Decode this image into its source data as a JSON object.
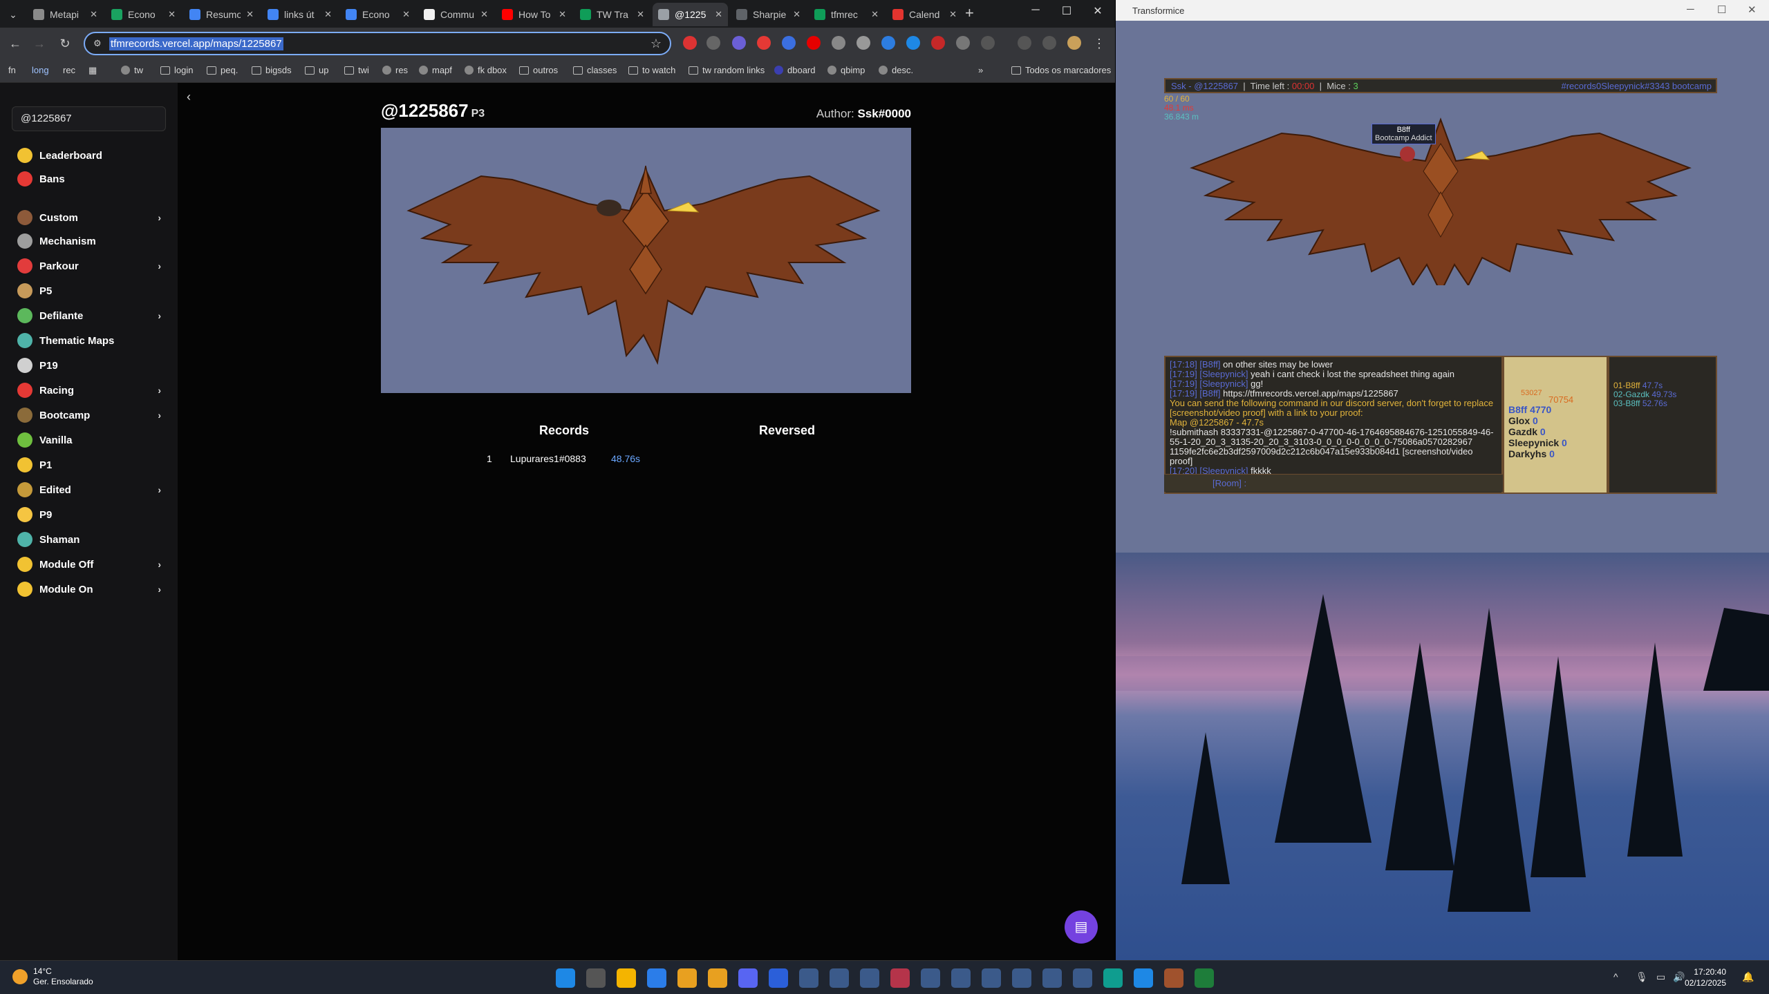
{
  "browser": {
    "tabs": [
      {
        "label": "Metapi",
        "color": "#8a8a8a",
        "active": false
      },
      {
        "label": "Econo",
        "color": "#1aa260",
        "active": false
      },
      {
        "label": "Resumo",
        "color": "#4285f4",
        "active": false
      },
      {
        "label": "links út",
        "color": "#4285f4",
        "active": false
      },
      {
        "label": "Econo",
        "color": "#4285f4",
        "active": false
      },
      {
        "label": "Commu",
        "color": "#f1f1f1",
        "active": false
      },
      {
        "label": "How To",
        "color": "#ff0000",
        "active": false
      },
      {
        "label": "TW Tra",
        "color": "#0f9d58",
        "active": false
      },
      {
        "label": "@1225",
        "color": "#9aa0a6",
        "active": true
      },
      {
        "label": "Sharpie",
        "color": "#5f6368",
        "active": false
      },
      {
        "label": "tfmrec",
        "color": "#0f9d58",
        "active": false
      },
      {
        "label": "Calend",
        "color": "#e3342f",
        "active": false
      }
    ],
    "url": "tfmrecords.vercel.app/maps/1225867",
    "bookmarks": [
      "fn",
      "long",
      "rec",
      "tw",
      "login",
      "peq.",
      "bigsds",
      "up",
      "twi",
      "res",
      "mapf",
      "fk dbox",
      "outros",
      "classes",
      "to watch",
      "tw random links",
      "dboard",
      "qbimp",
      "desc.",
      "Todos os marcadores"
    ]
  },
  "sidebar": {
    "search_value": "@1225867",
    "items": [
      {
        "label": "Leaderboard",
        "icon": "crown-icon",
        "color": "#f1c232",
        "arrow": false
      },
      {
        "label": "Bans",
        "icon": "ban-icon",
        "color": "#e53935",
        "arrow": false
      },
      {
        "label": "Custom",
        "icon": "house-icon",
        "color": "#8d5a3a",
        "arrow": true
      },
      {
        "label": "Mechanism",
        "icon": "gear-icon",
        "color": "#9e9e9e",
        "arrow": false
      },
      {
        "label": "Parkour",
        "icon": "heart-icon",
        "color": "#e23c3c",
        "arrow": true
      },
      {
        "label": "P5",
        "icon": "brush-icon",
        "color": "#c79a5a",
        "arrow": false
      },
      {
        "label": "Defilante",
        "icon": "flag-icon",
        "color": "#5cb85c",
        "arrow": true
      },
      {
        "label": "Thematic Maps",
        "icon": "sparkle-icon",
        "color": "#4fb3a9",
        "arrow": false
      },
      {
        "label": "P19",
        "icon": "globe-icon",
        "color": "#d0d0d0",
        "arrow": false
      },
      {
        "label": "Racing",
        "icon": "racing-icon",
        "color": "#e53935",
        "arrow": true
      },
      {
        "label": "Bootcamp",
        "icon": "boot-icon",
        "color": "#8b6b3a",
        "arrow": true
      },
      {
        "label": "Vanilla",
        "icon": "grass-icon",
        "color": "#6fbf3f",
        "arrow": false
      },
      {
        "label": "P1",
        "icon": "lock-icon",
        "color": "#f1c232",
        "arrow": false
      },
      {
        "label": "Edited",
        "icon": "edit-icon",
        "color": "#c59a3a",
        "arrow": true
      },
      {
        "label": "P9",
        "icon": "cheese-icon",
        "color": "#f5c542",
        "arrow": false
      },
      {
        "label": "Shaman",
        "icon": "feather-icon",
        "color": "#4fb3a9",
        "arrow": false
      },
      {
        "label": "Module Off",
        "icon": "moon-icon",
        "color": "#f1c232",
        "arrow": true
      },
      {
        "label": "Module On",
        "icon": "moon-icon",
        "color": "#f1c232",
        "arrow": true
      }
    ]
  },
  "main": {
    "title": "@1225867",
    "category": "P3",
    "author_label": "Author:",
    "author": "Ssk#0000",
    "records_header": "Records",
    "reversed_header": "Reversed",
    "records": [
      {
        "rank": "1",
        "player": "Lupurares1#0883",
        "time": "48.76s"
      }
    ]
  },
  "tfm": {
    "window_title": "Transformice",
    "top_bar": {
      "player": "Ssk - @1225867",
      "time_left_label": "Time left :",
      "time_left": "00:00",
      "mice_label": "Mice :",
      "mice": "3",
      "room": "#records0Sleepynick#3343 bootcamp"
    },
    "stats": [
      "60 / 60",
      "48.1 ms",
      "36.843 m"
    ],
    "tooltip": {
      "name": "B8ff",
      "title": "Bootcamp Addict"
    },
    "chat": [
      {
        "ts": "[17:18]",
        "name": "[B8ff]",
        "msg": "on other sites may be lower"
      },
      {
        "ts": "[17:19]",
        "name": "[Sleepynick]",
        "msg": "yeah i cant check i lost the spreadsheet thing again"
      },
      {
        "ts": "[17:19]",
        "name": "[Sleepynick]",
        "msg": "gg!"
      },
      {
        "ts": "[17:19]",
        "name": "[B8ff]",
        "msg": "https://tfmrecords.vercel.app/maps/1225867"
      }
    ],
    "system_msg": "You can send the following command in our discord server, don't forget to replace [screenshot/video proof] with a link to your proof:",
    "map_line": "Map @1225867 - 47.7s",
    "hash_line": "!submithash 83337331-@1225867-0-47700-46-1764695884676-1251055849-46-55-1-20_20_3_3135-20_20_3_3103-0_0_0_0-0_0_0_0-75086a0570282967 1159fe2fc6e2b3df2597009d2c212c6b047a15e933b084d1 [screenshot/video proof]",
    "last_chat": {
      "ts": "[17:20]",
      "name": "[Sleepynick]",
      "msg": "fkkkk"
    },
    "chat_input": "[Room] :",
    "cheese": "53027",
    "firsts": "70754",
    "players": [
      {
        "name": "B8ff",
        "score": "4770"
      },
      {
        "name": "Glox",
        "score": "0"
      },
      {
        "name": "Gazdk",
        "score": "0"
      },
      {
        "name": "Sleepynick",
        "score": "0"
      },
      {
        "name": "Darkyhs",
        "score": "0"
      }
    ],
    "ranks": [
      {
        "label": "01-B8ff",
        "time": "47.7s"
      },
      {
        "label": "02-Gazdk",
        "time": "49.73s"
      },
      {
        "label": "03-B8ff",
        "time": "52.76s"
      }
    ]
  },
  "taskbar": {
    "weather_temp": "14°C",
    "weather_desc": "Ger. Ensolarado",
    "time": "17:20:40",
    "date": "02/12/2025"
  }
}
